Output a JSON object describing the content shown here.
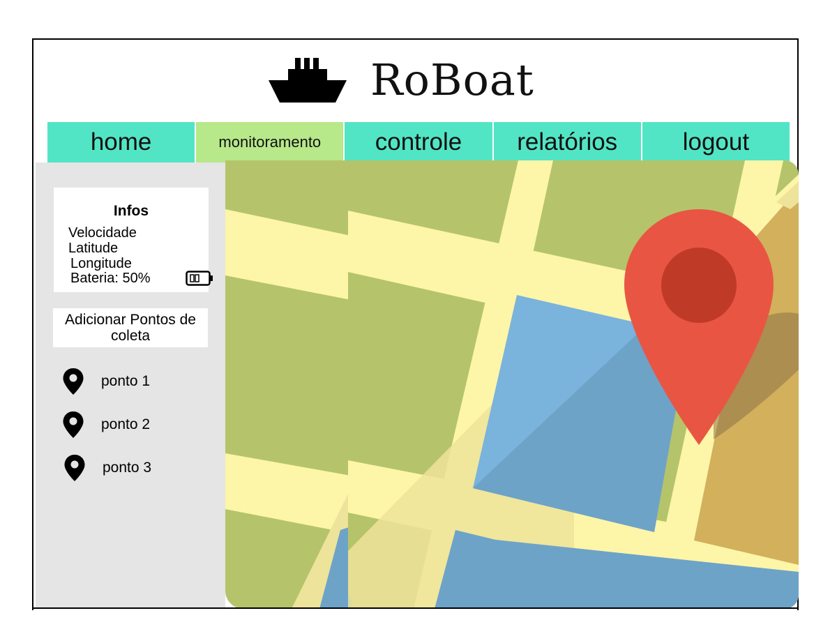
{
  "header": {
    "title": "RoBoat",
    "logo_icon": "ship-icon"
  },
  "nav": {
    "items": [
      {
        "label": "home",
        "active": false
      },
      {
        "label": "monitoramento",
        "active": true
      },
      {
        "label": "controle",
        "active": false
      },
      {
        "label": "relatórios",
        "active": false
      },
      {
        "label": "logout",
        "active": false
      }
    ]
  },
  "sidebar": {
    "info": {
      "title": "Infos",
      "speed_label": "Velocidade",
      "latitude_label": "Latitude",
      "longitude_label": "Longitude",
      "battery_label": "Bateria: 50%",
      "battery_level": 0.5
    },
    "add_points_label": "Adicionar Pontos de coleta",
    "points": [
      {
        "label": "ponto 1",
        "icon": "map-pin-icon"
      },
      {
        "label": "ponto 2",
        "icon": "map-pin-icon"
      },
      {
        "label": "ponto 3",
        "icon": "map-pin-icon"
      }
    ]
  },
  "map": {
    "marker_icon": "location-marker-icon",
    "colors": {
      "land": "#b5c46a",
      "road": "#fdf5a8",
      "road_shade": "#ede39a",
      "water": "#7ab3dc",
      "water_shade": "#6ea3c8",
      "sand": "#d2b05c",
      "marker": "#e95543",
      "marker_center": "#bf3a27"
    }
  },
  "theme": {
    "nav_color": "#52e5c5",
    "nav_active_color": "#b7e889",
    "sidebar_bg": "#e5e5e5"
  }
}
